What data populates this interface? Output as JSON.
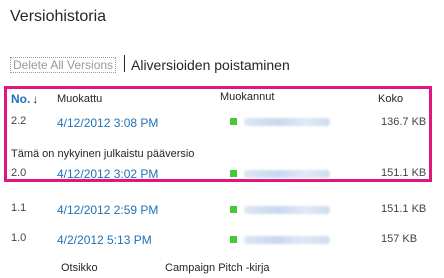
{
  "page": {
    "title": "Versiohistoria"
  },
  "actions": {
    "delete_all": "Delete All Versions",
    "delete_minor": "Aliversioiden poistaminen"
  },
  "table": {
    "headers": {
      "no": "No.",
      "sort_indicator": "↓",
      "modified": "Muokattu",
      "modified_by": "Muokannut",
      "size": "Koko"
    },
    "published_note": "Tämä on nykyinen julkaistu pääversio",
    "rows": [
      {
        "version": "2.2",
        "date": "4/12/2012 3:08 PM",
        "size": "136.7 KB"
      },
      {
        "version": "2.0",
        "date": "4/12/2012 3:02 PM",
        "size": "151.1 KB"
      },
      {
        "version": "1.1",
        "date": "4/12/2012 2:59 PM",
        "size": "151.1 KB"
      },
      {
        "version": "1.0",
        "date": "4/2/2012 5:13 PM",
        "size": "157 KB"
      }
    ],
    "user_status_color": "#46c83a",
    "highlight_color": "#e0157f",
    "link_color": "#2072b8"
  },
  "footer": {
    "label": "Otsikko",
    "value": "Campaign Pitch -kirja"
  }
}
